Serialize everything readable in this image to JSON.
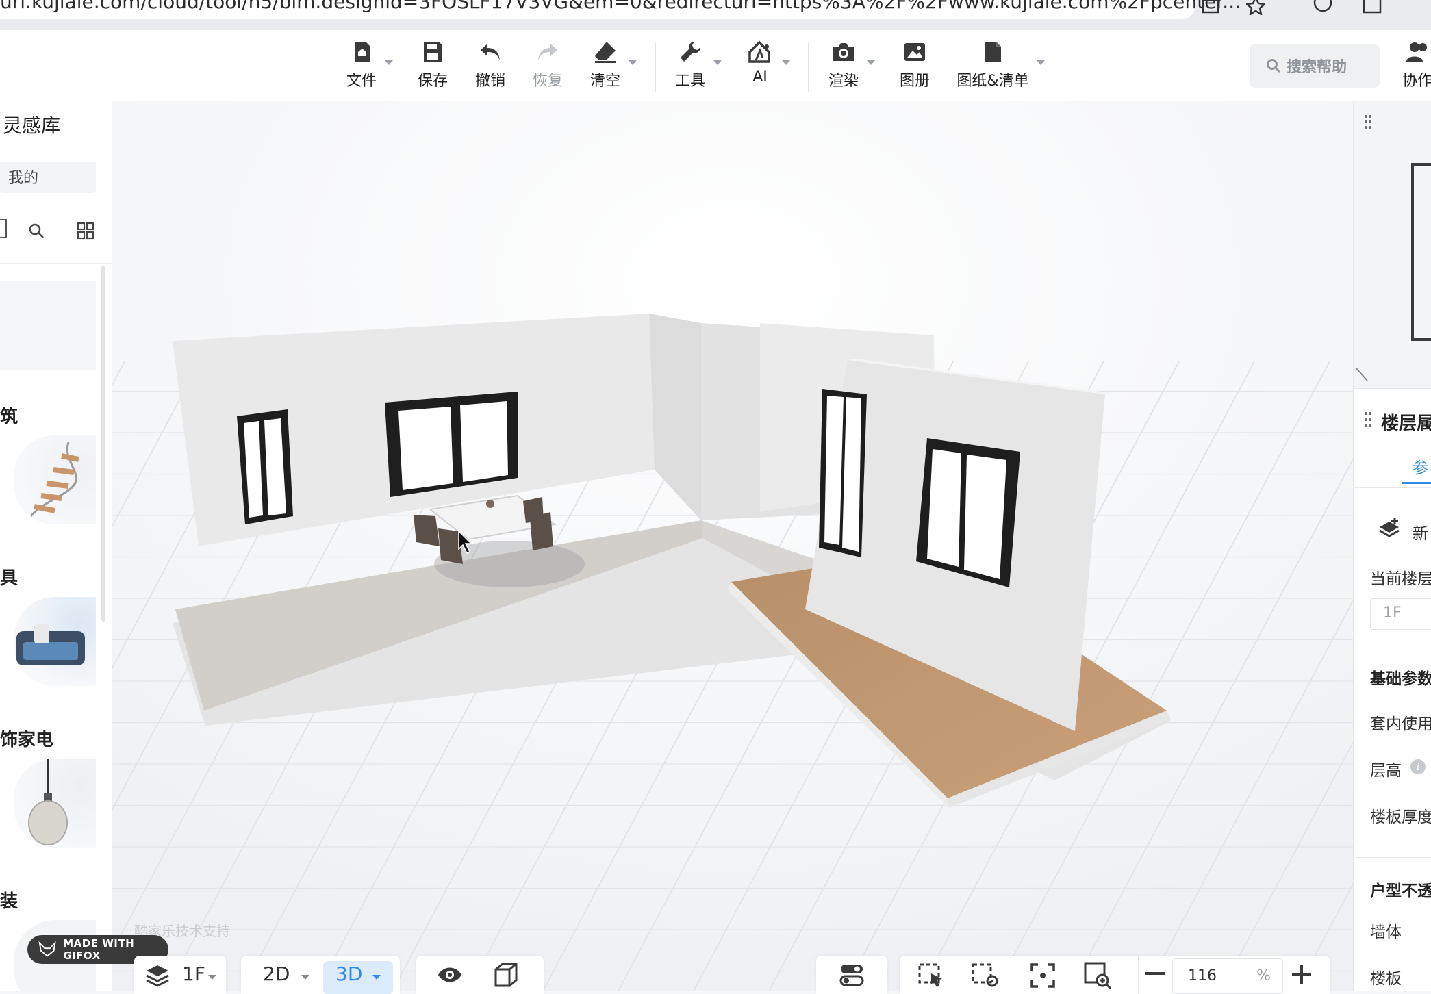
{
  "browser": {
    "url": "uri.kujiale.com/cloud/tool/h5/bim.designid=3FOSLF17V3VG&em=0&redirecturl=https%3A%2F%2Fwww.kujiale.com%2Fpcenter..."
  },
  "toolbar": {
    "items": [
      {
        "label": "文件",
        "icon": "file-home-icon",
        "dropdown": true
      },
      {
        "label": "保存",
        "icon": "save-icon",
        "dropdown": false
      },
      {
        "label": "撤销",
        "icon": "undo-icon",
        "dropdown": false
      },
      {
        "label": "恢复",
        "icon": "redo-icon",
        "dropdown": false,
        "disabled": true
      },
      {
        "label": "清空",
        "icon": "eraser-icon",
        "dropdown": true
      },
      {
        "label": "工具",
        "icon": "wrench-icon",
        "dropdown": true
      },
      {
        "label": "AI",
        "icon": "ai-icon",
        "dropdown": true
      },
      {
        "label": "渲染",
        "icon": "camera-icon",
        "dropdown": true
      },
      {
        "label": "图册",
        "icon": "image-icon",
        "dropdown": false
      },
      {
        "label": "图纸&清单",
        "icon": "document-icon",
        "dropdown": true
      }
    ],
    "help_search": "搜索帮助",
    "collab": "协作"
  },
  "left_panel": {
    "title": "灵感库",
    "tab_mine": "我的",
    "categories": [
      {
        "label": "筑"
      },
      {
        "label": "具"
      },
      {
        "label": "饰家电"
      },
      {
        "label": "装"
      }
    ]
  },
  "right_panel": {
    "section_title": "楼层属",
    "tab": "参",
    "new_floor": "新",
    "current_floor_label": "当前楼层",
    "current_floor_value": "1F",
    "basic_params": "基础参数",
    "inner_area": "套内使用",
    "floor_height": "层高",
    "slab_thickness": "楼板厚度",
    "opacity_title": "户型不透",
    "wall": "墙体",
    "slab": "楼板"
  },
  "bottom_bar": {
    "floor": "1F",
    "view_2d": "2D",
    "view_3d": "3D",
    "zoom_value": "116",
    "zoom_unit": "%"
  },
  "watermark": "酷家乐技术支持",
  "gifox": "MADE WITH GIFOX",
  "colors": {
    "accent": "#2f8ae8",
    "active_bg": "#dcebfb"
  }
}
